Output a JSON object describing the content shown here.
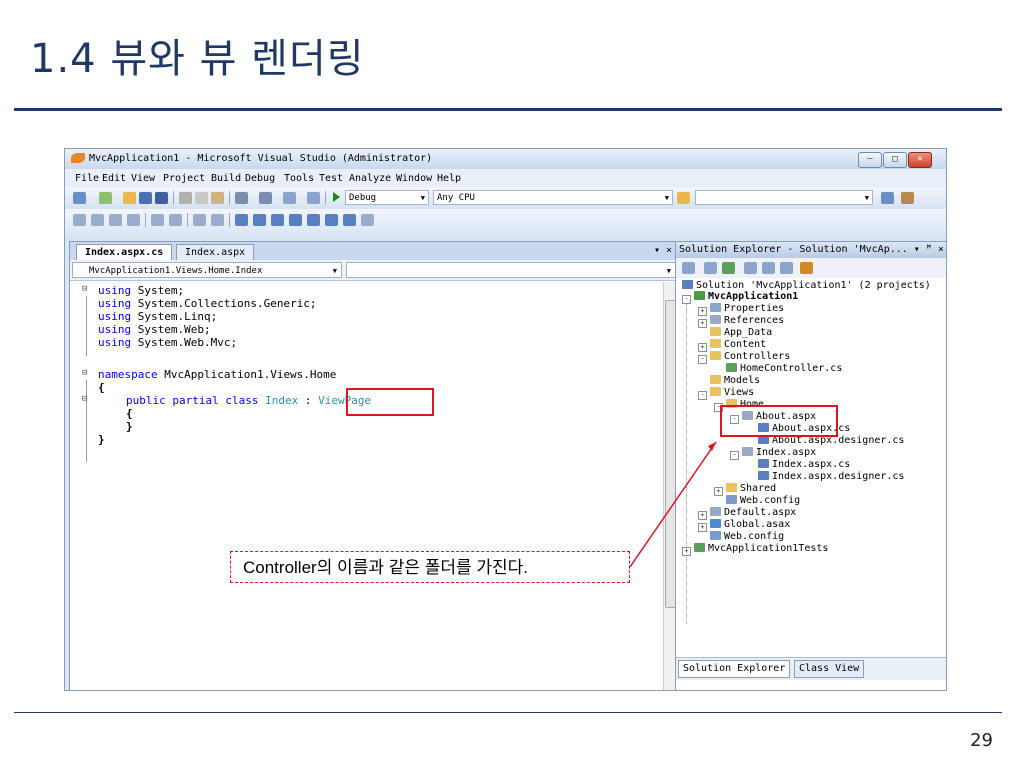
{
  "slide": {
    "title": "1.4 뷰와 뷰 렌더링",
    "page_number": "29"
  },
  "window": {
    "title": "MvcApplication1 - Microsoft Visual Studio (Administrator)",
    "menu": [
      "File",
      "Edit",
      "View",
      "Project",
      "Build",
      "Debug",
      "Tools",
      "Test",
      "Analyze",
      "Window",
      "Help"
    ],
    "toolbar": {
      "config": "Debug",
      "platform": "Any CPU"
    }
  },
  "editor": {
    "tabs": [
      "Index.aspx.cs",
      "Index.aspx"
    ],
    "nav_class": "MvcApplication1.Views.Home.Index",
    "code_lines": [
      {
        "kw": "using",
        "text": " System;"
      },
      {
        "kw": "using",
        "text": " System.Collections.Generic;"
      },
      {
        "kw": "using",
        "text": " System.Linq;"
      },
      {
        "kw": "using",
        "text": " System.Web;"
      },
      {
        "kw": "using",
        "text": " System.Web.Mvc;"
      },
      {
        "kw": "namespace",
        "text": " MvcApplication1.Views.Home"
      },
      {
        "text": "{"
      },
      {
        "kw": "public partial class",
        "ty": " Index",
        "text": " : ",
        "ty2": "ViewPage"
      },
      {
        "text": "{"
      },
      {
        "text": "}"
      },
      {
        "text": "}"
      }
    ]
  },
  "solution_explorer": {
    "header": "Solution Explorer - Solution 'MvcAp... ▾ ꟸ ×",
    "nodes": [
      "Solution 'MvcApplication1' (2 projects)",
      "MvcApplication1",
      "Properties",
      "References",
      "App_Data",
      "Content",
      "Controllers",
      "HomeController.cs",
      "Models",
      "Views",
      "Home",
      "About.aspx",
      "About.aspx.cs",
      "About.aspx.designer.cs",
      "Index.aspx",
      "Index.aspx.cs",
      "Index.aspx.designer.cs",
      "Shared",
      "Web.config",
      "Default.aspx",
      "Global.asax",
      "Web.config",
      "MvcApplication1Tests"
    ],
    "bottom_tabs": [
      "Solution Explorer",
      "Class View"
    ]
  },
  "callout": {
    "text": "Controller의 이름과 같은 폴더를 가진다.",
    "color": "#e0141e"
  }
}
